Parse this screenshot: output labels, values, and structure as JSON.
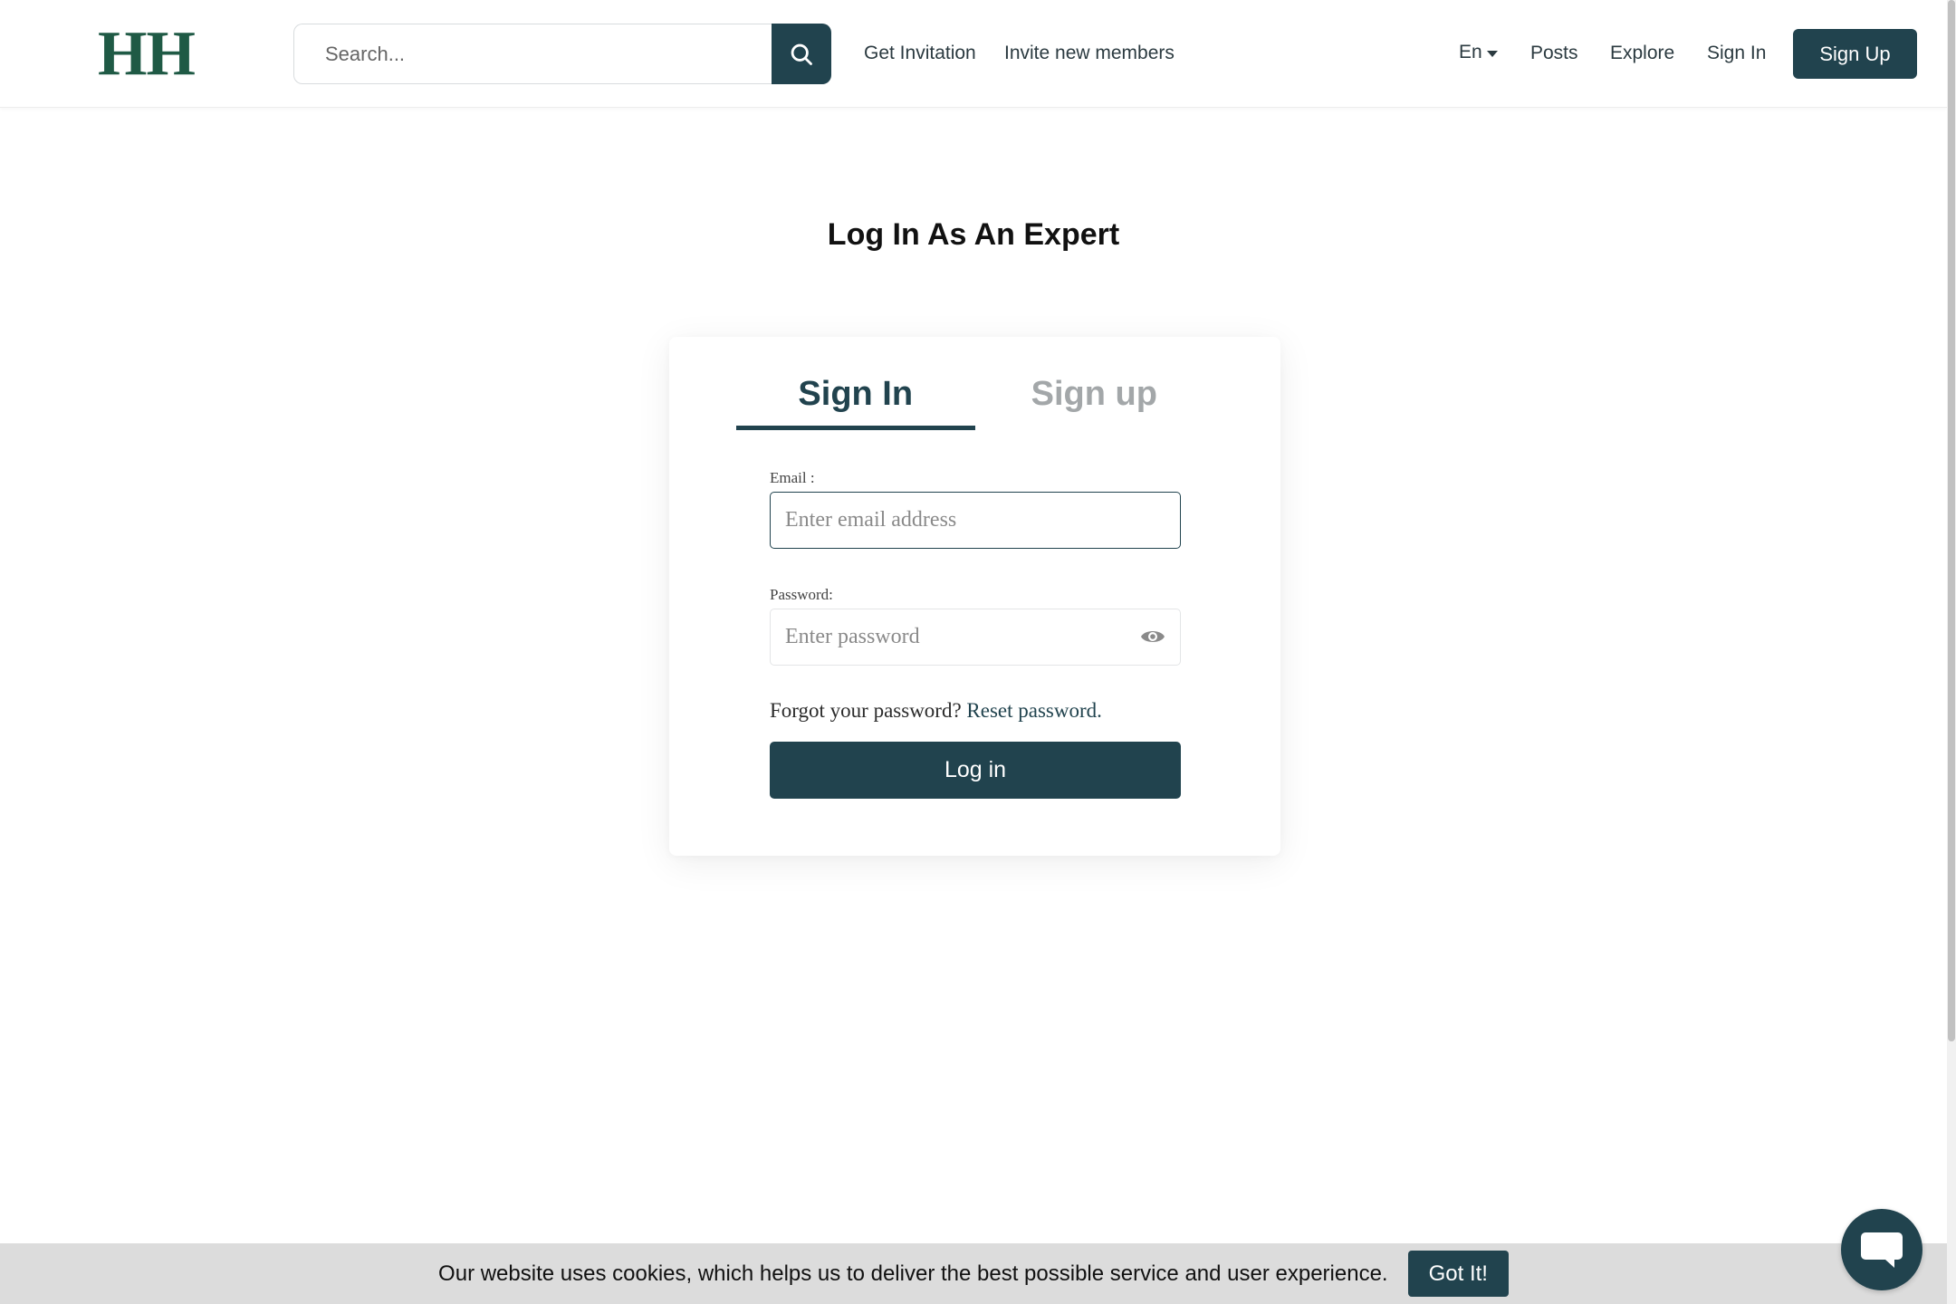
{
  "header": {
    "logo": "HH",
    "search": {
      "placeholder": "Search..."
    },
    "nav": {
      "get_invitation": "Get Invitation",
      "invite_members": "Invite new members",
      "language": "En",
      "posts": "Posts",
      "explore": "Explore",
      "sign_in": "Sign In",
      "sign_up": "Sign Up"
    }
  },
  "main": {
    "title": "Log In As An Expert",
    "tabs": [
      {
        "label": "Sign In",
        "active": true
      },
      {
        "label": "Sign up",
        "active": false
      }
    ],
    "form": {
      "email_label": "Email :",
      "email_placeholder": "Enter email address",
      "password_label": "Password:",
      "password_placeholder": "Enter password",
      "forgot_text": "Forgot your password?",
      "reset_link": "Reset password.",
      "login_button": "Log in"
    }
  },
  "cookie_banner": {
    "text": "Our website uses cookies, which helps us to deliver the best possible service and user experience.",
    "button": "Got It!"
  },
  "colors": {
    "primary": "#21434e",
    "logo": "#1f5a45",
    "banner_bg": "#dcdcdc"
  },
  "icons": {
    "search": "search-icon",
    "caret": "caret-down-icon",
    "password_toggle": "eye-icon",
    "chat": "chat-bubble-icon"
  }
}
